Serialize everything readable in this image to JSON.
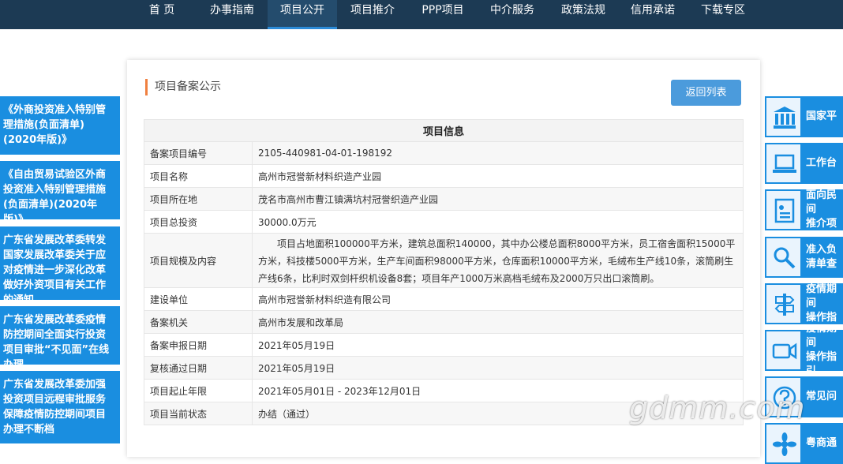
{
  "nav": {
    "items": [
      "首 页",
      "办事指南",
      "项目公开",
      "项目推介",
      "PPP项目",
      "中介服务",
      "政策法规",
      "信用承诺",
      "下载专区"
    ],
    "active_index": 2
  },
  "left_links": [
    "《外商投资准入特别管理措施(负面清单)(2020年版)》",
    "《自由贸易试验区外商投资准入特别管理措施(负面清单)(2020年版)》",
    "广东省发展改革委转发国家发展改革委关于应对疫情进一步深化改革做好外资项目有关工作的通知",
    "广东省发展改革委疫情防控期间全面实行投资项目审批“不见面”在线办理",
    "广东省发展改革委加强投资项目远程审批服务保障疫情防控期间项目办理不断档"
  ],
  "panel": {
    "title": "项目备案公示",
    "back_button": "返回列表",
    "table_header": "项目信息",
    "rows": [
      {
        "label": "备案项目编号",
        "value": "2105-440981-04-01-198192"
      },
      {
        "label": "项目名称",
        "value": "高州市冠誉新材料织造产业园"
      },
      {
        "label": "项目所在地",
        "value": "茂名市高州市曹江镇满坑村冠誉织造产业园"
      },
      {
        "label": "项目总投资",
        "value": "30000.0万元"
      },
      {
        "label": "项目规模及内容",
        "value": "项目占地面积100000平方米，建筑总面积140000，其中办公楼总面积8000平方米，员工宿舍面积15000平方米，科技楼5000平方米，生产车间面积98000平方米，仓库面积10000平方米，毛绒布生产线10条，滚筒刷生产线6条，比利时双剑杆织机设备8套；项目年产1000万米高档毛绒布及2000万只出口滚筒刷。"
      },
      {
        "label": "建设单位",
        "value": "高州市冠誉新材料织造有限公司"
      },
      {
        "label": "备案机关",
        "value": "高州市发展和改革局"
      },
      {
        "label": "备案申报日期",
        "value": "2021年05月19日"
      },
      {
        "label": "复核通过日期",
        "value": "2021年05月19日"
      },
      {
        "label": "项目起止年限",
        "value": "2021年05月01日 - 2023年12月01日"
      },
      {
        "label": "项目当前状态",
        "value": "办结（通过）"
      }
    ]
  },
  "right_tiles": [
    {
      "label": "国家平",
      "icon": "building-icon"
    },
    {
      "label": "工作台",
      "icon": "laptop-icon"
    },
    {
      "label": "面向民间\n推介项",
      "icon": "document-icon"
    },
    {
      "label": "准入负\n清单查",
      "icon": "search-icon"
    },
    {
      "label": "疫情期间\n操作指",
      "icon": "signpost-icon"
    },
    {
      "label": "疫情期间\n操作指引",
      "icon": "video-icon"
    },
    {
      "label": "常见问",
      "icon": "question-icon"
    },
    {
      "label": "粤商通",
      "icon": "flower-icon"
    }
  ],
  "watermark": "gdmm.com",
  "colors": {
    "nav_bg": "#1c3a54",
    "accent_blue": "#1a8ee0",
    "title_bar": "#f08040",
    "button": "#4b9bdc"
  }
}
